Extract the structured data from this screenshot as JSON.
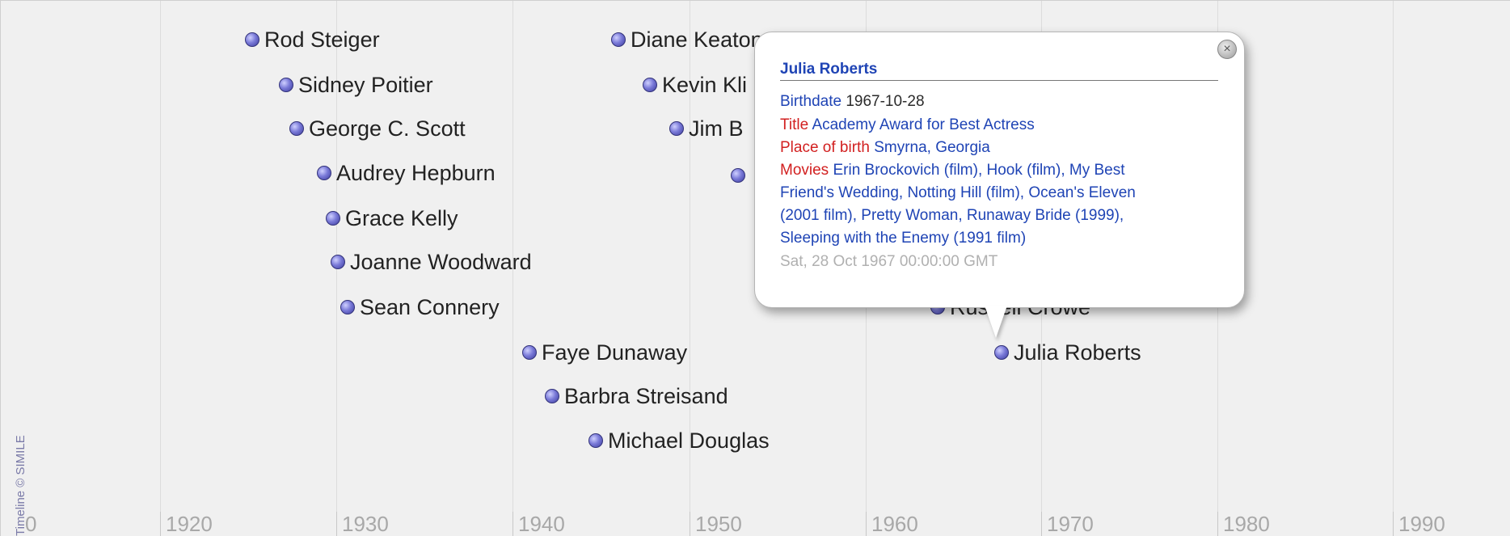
{
  "credit": "Timeline © SIMILE",
  "axis": {
    "ticks": [
      "0",
      "1920",
      "1930",
      "1940",
      "1950",
      "1960",
      "1970",
      "1980",
      "1990"
    ]
  },
  "events": [
    {
      "name": "Rod Steiger"
    },
    {
      "name": "Sidney Poitier"
    },
    {
      "name": "George C. Scott"
    },
    {
      "name": "Audrey Hepburn"
    },
    {
      "name": "Grace Kelly"
    },
    {
      "name": "Joanne Woodward"
    },
    {
      "name": "Sean Connery"
    },
    {
      "name": "Faye Dunaway"
    },
    {
      "name": "Barbra Streisand"
    },
    {
      "name": "Michael Douglas"
    },
    {
      "name": "Diane Keaton"
    },
    {
      "name": "Kevin Kli"
    },
    {
      "name": "Jim B"
    },
    {
      "name": ""
    },
    {
      "name": "Russell Crowe"
    },
    {
      "name": "Julia Roberts"
    }
  ],
  "bubble": {
    "title": "Julia Roberts",
    "birthdate_label": "Birthdate",
    "birthdate_value": "1967-10-28",
    "title_label": "Title",
    "title_value": "Academy Award for Best Actress",
    "place_label": "Place of birth",
    "place_value": "Smyrna, Georgia",
    "movies_label": "Movies",
    "movies_line1": "Erin Brockovich (film), Hook (film), My Best",
    "movies_line2": "Friend's Wedding, Notting Hill (film), Ocean's Eleven",
    "movies_line3": "(2001 film), Pretty Woman, Runaway Bride (1999),",
    "movies_line4": "Sleeping with the Enemy (1991 film)",
    "date_line": "Sat, 28 Oct 1967 00:00:00 GMT",
    "close_glyph": "×"
  }
}
